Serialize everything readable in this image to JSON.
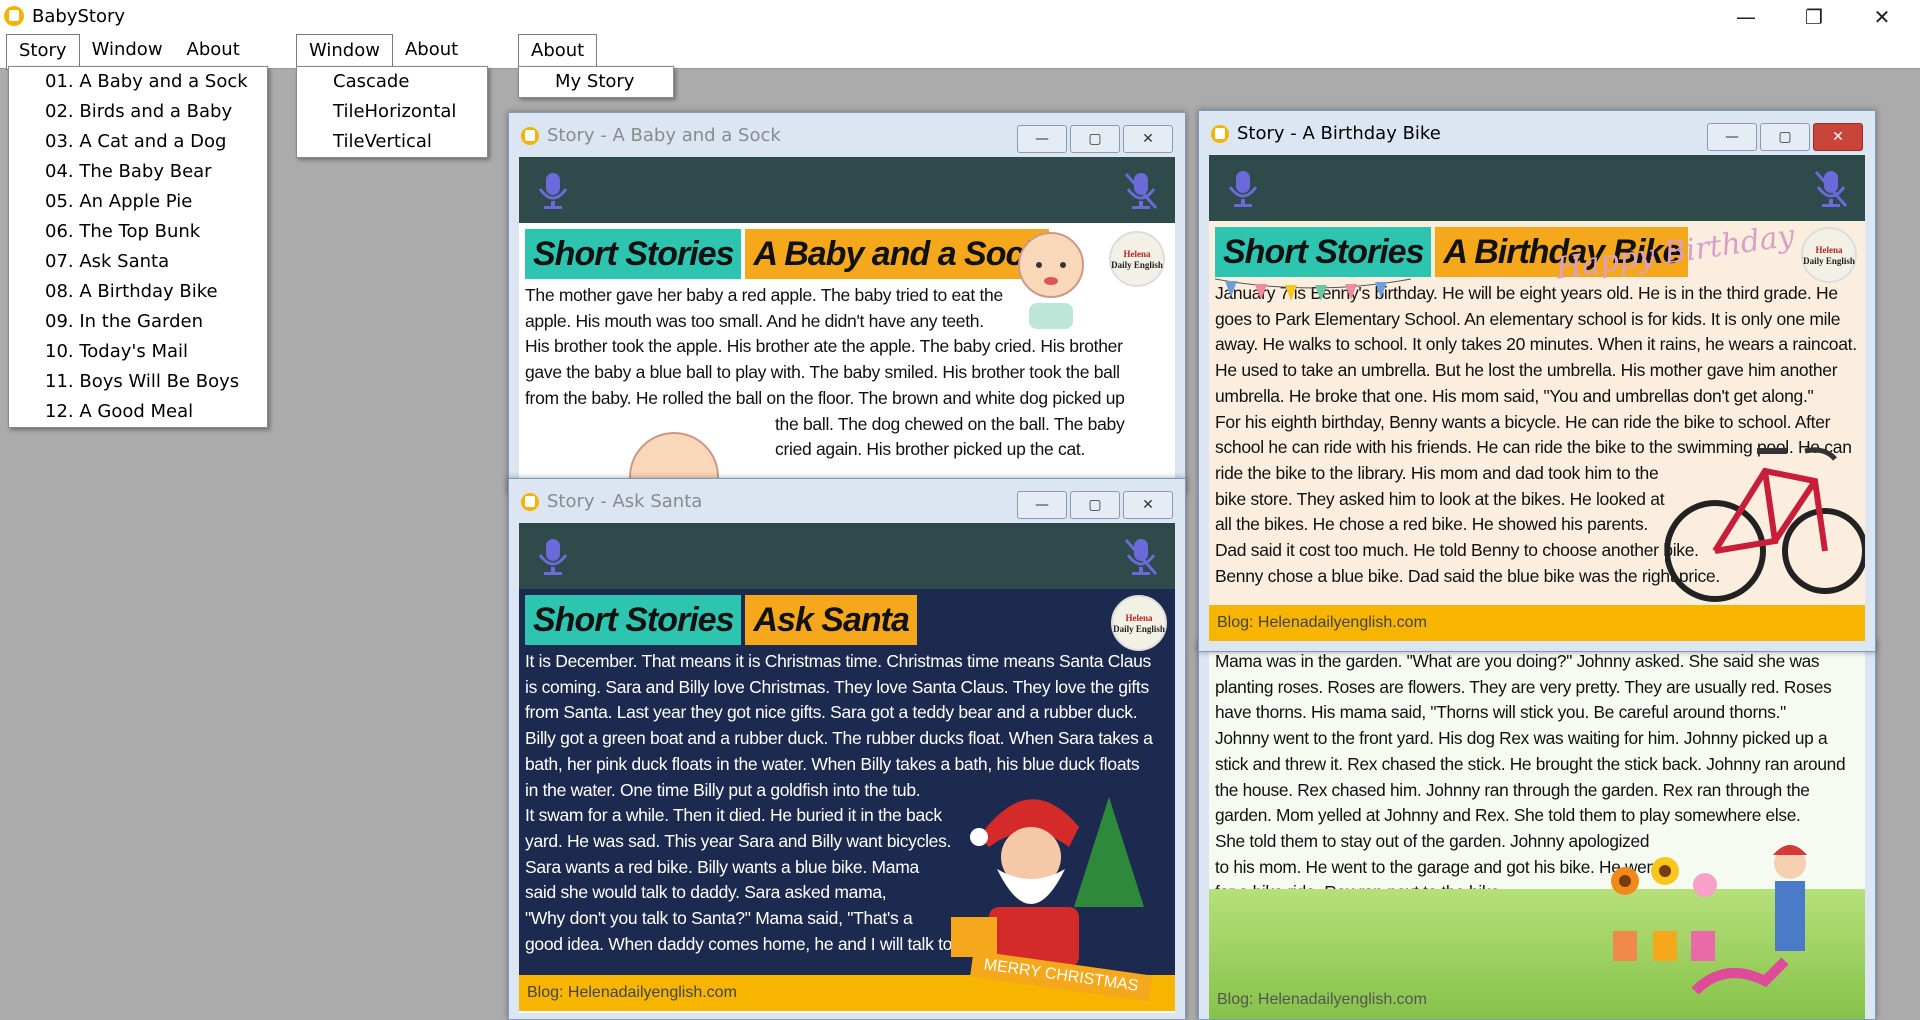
{
  "app": {
    "title": "BabyStory"
  },
  "window_controls": {
    "minimize": "—",
    "maximize": "❐",
    "close": "✕"
  },
  "menus": [
    {
      "labels": [
        "Story",
        "Window",
        "About"
      ],
      "selected": "Story"
    },
    {
      "labels": [
        "Window",
        "About"
      ],
      "selected": "Window"
    },
    {
      "labels": [
        "About"
      ],
      "selected": "About"
    }
  ],
  "story_menu": [
    "01. A Baby and a Sock",
    "02. Birds and a Baby",
    "03. A Cat and a Dog",
    "04. The Baby Bear",
    "05. An Apple Pie",
    "06. The Top Bunk",
    "07. Ask Santa",
    "08. A Birthday Bike",
    "09. In the Garden",
    "10. Today's Mail",
    "11. Boys Will Be Boys",
    "12. A Good Meal"
  ],
  "window_menu": [
    "Cascade",
    "TileHorizontal",
    "TileVertical"
  ],
  "about_menu": [
    "My Story"
  ],
  "child_window_buttons": {
    "minimize": "—",
    "maximize": "▢",
    "close": "✕"
  },
  "windows": {
    "baby_sock": {
      "title": "Story - A Baby and a Sock",
      "badge_series": "Short Stories",
      "badge_title": "A Baby and a Sock",
      "text_lines": [
        "The mother gave her baby a red apple. The baby tried to eat the",
        "apple. His mouth was too small. And he didn't have any teeth.",
        "His brother took the apple. His brother ate the apple. The baby cried. His brother",
        "gave the baby a blue ball to play with. The baby smiled. His brother took the ball",
        "from the baby. He rolled the ball on the floor. The brown and white dog picked up",
        "the ball. The dog chewed on the ball. The baby",
        "cried again. His brother picked up the cat."
      ]
    },
    "ask_santa": {
      "title": "Story - Ask Santa",
      "badge_series": "Short Stories",
      "badge_title": "Ask Santa",
      "text_lines": [
        "It is December. That means it is Christmas time. Christmas time means Santa Claus",
        "is coming. Sara and Billy love Christmas. They love Santa Claus. They love the gifts",
        "from Santa. Last year they got nice gifts. Sara got a teddy bear and a rubber duck.",
        "Billy got a green boat and a rubber duck. The rubber ducks float. When Sara takes a",
        "bath, her pink duck floats in the water. When Billy takes a bath, his blue duck floats",
        "in the water. One time Billy put a goldfish into the tub.",
        "It swam for a while. Then it died. He buried it in the back",
        "yard. He was sad. This year Sara and Billy want bicycles.",
        "Sara wants a red bike. Billy wants a blue bike. Mama",
        "said she would talk to daddy. Sara asked mama,",
        "\"Why don't you talk to Santa?\" Mama said, \"That's a",
        "good idea. When daddy comes home, he and I will talk to Santa.\""
      ],
      "banner": "MERRY CHRISTMAS",
      "footer": "Blog: Helenadailyenglish.com"
    },
    "birthday_bike": {
      "title": "Story - A Birthday Bike",
      "badge_series": "Short Stories",
      "badge_title": "A Birthday Bike",
      "text_lines": [
        "January 7 is Benny's birthday. He will be eight years old. He is in the third grade. He",
        "goes to Park Elementary School. An elementary school is for kids. It is only one mile",
        "away. He walks to school. It only takes 20 minutes. When it rains, he wears a raincoat.",
        "He used to take an umbrella. But he lost the umbrella. His mother gave him another",
        "umbrella. He broke that one. His mom said, \"You and umbrellas don't get along.\"",
        "For his eighth birthday, Benny wants a bicycle. He can ride the bike to school. After",
        "school he can ride with his friends. He can ride the bike to the swimming pool. He can",
        "ride the bike to the library. His mom and dad took him to the",
        "bike store. They asked him to look at the bikes. He looked at",
        "all the bikes. He chose a red bike. He showed his parents.",
        "Dad said it cost too much. He told Benny to choose another bike.",
        "Benny chose a blue bike. Dad said the blue bike was the right price."
      ],
      "footer": "Blog: Helenadailyenglish.com",
      "decor": "Happy Birthday"
    },
    "in_the_garden": {
      "text_lines": [
        "Mama was in the garden. \"What are you doing?\" Johnny asked. She said she was",
        "planting roses. Roses are flowers. They are very pretty. They are usually red. Roses",
        "have thorns. His mama said, \"Thorns will stick you. Be careful around thorns.\"",
        "Johnny went to the front yard. His dog Rex was waiting for him. Johnny picked up a",
        "stick and threw it. Rex chased the stick. He brought the stick back. Johnny ran around",
        "the house. Rex chased him. Johnny ran through the garden. Rex ran through the",
        "garden. Mom yelled at Johnny and Rex. She told them to play somewhere else.",
        "She told them to stay out of the garden. Johnny apologized",
        "to his mom. He went to the garage and got his bike. He went",
        "for a bike ride. Rex ran next to the bike."
      ],
      "footer": "Blog: Helenadailyenglish.com"
    }
  },
  "logo": {
    "line1": "Helena",
    "line2": "Daily English"
  },
  "colors": {
    "toolbar": "#2f4a4a",
    "mic": "#6a6ad8",
    "teal_badge": "#2ec5b0",
    "orange_badge": "#f5a81c",
    "footer": "#f7b500",
    "santa_bg": "#1d2a4f"
  }
}
